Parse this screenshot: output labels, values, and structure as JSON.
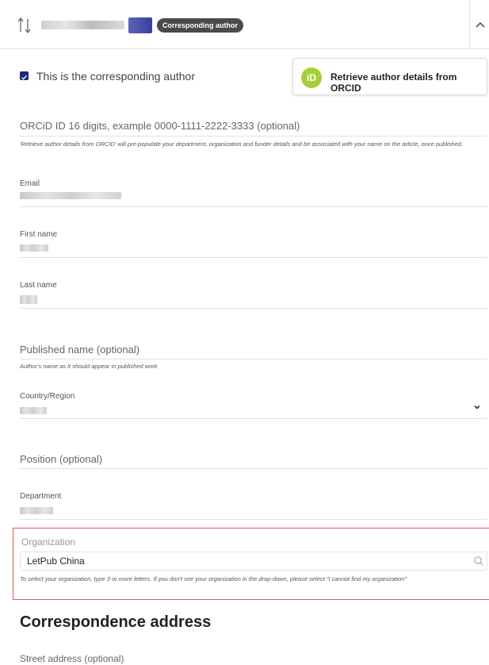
{
  "header": {
    "badge": "Corresponding author",
    "icons": {
      "reorder": "reorder-arrows-icon",
      "collapse": "chevron-up-icon"
    }
  },
  "corresponding": {
    "checked": true,
    "label": "This is the corresponding author"
  },
  "orcid_button": {
    "icon_text": "iD",
    "label": "Retrieve author details from ORCID",
    "icon_color": "#a6ce39"
  },
  "orcid_field": {
    "placeholder": "ORCiD ID 16 digits, example 0000-1111-2222-3333 (optional)",
    "hint": "'Retrieve author details from ORCID' will pre-populate your department, organization and funder details and be associated with your name on the article, once published."
  },
  "fields": {
    "email_label": "Email",
    "first_name_label": "First name",
    "last_name_label": "Last name",
    "published_name_placeholder": "Published name (optional)",
    "published_name_hint": "Author's name as it should appear in published work",
    "country_label": "Country/Region",
    "position_placeholder": "Position (optional)",
    "department_label": "Department"
  },
  "organization": {
    "label": "Organization",
    "value": "LetPub China",
    "hint": "To select your organization, type 3 or more letters. If you don't see your organization in the drop-down, please select \"I cannot find my organization\"",
    "highlight_color": "#e05a5a"
  },
  "correspondence": {
    "title": "Correspondence address",
    "street_placeholder": "Street address (optional)"
  }
}
